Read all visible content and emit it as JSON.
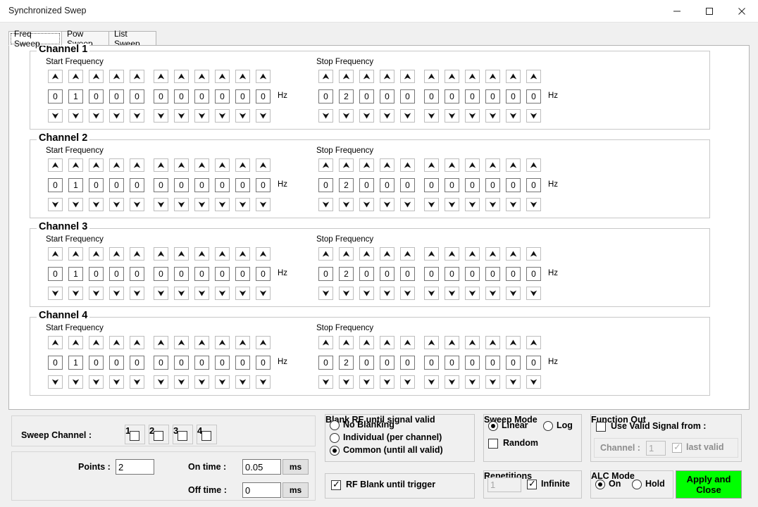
{
  "window": {
    "title": "Synchronized Swep",
    "minimize_label": "—",
    "maximize_label": "□",
    "close_label": "✕"
  },
  "tabs": [
    {
      "label": "Freq Sweep",
      "active": true
    },
    {
      "label": "Pow Sweep",
      "active": false
    },
    {
      "label": "List Sweep",
      "active": false
    }
  ],
  "channels": [
    {
      "title": "Channel 1",
      "start": {
        "label": "Start Frequency",
        "digits": [
          "0",
          "1",
          "0",
          "0",
          "0",
          "0",
          "0",
          "0",
          "0",
          "0",
          "0"
        ],
        "unit": "Hz"
      },
      "stop": {
        "label": "Stop Frequency",
        "digits": [
          "0",
          "2",
          "0",
          "0",
          "0",
          "0",
          "0",
          "0",
          "0",
          "0",
          "0"
        ],
        "unit": "Hz"
      }
    },
    {
      "title": "Channel 2",
      "start": {
        "label": "Start Frequency",
        "digits": [
          "0",
          "1",
          "0",
          "0",
          "0",
          "0",
          "0",
          "0",
          "0",
          "0",
          "0"
        ],
        "unit": "Hz"
      },
      "stop": {
        "label": "Stop Frequency",
        "digits": [
          "0",
          "2",
          "0",
          "0",
          "0",
          "0",
          "0",
          "0",
          "0",
          "0",
          "0"
        ],
        "unit": "Hz"
      }
    },
    {
      "title": "Channel 3",
      "start": {
        "label": "Start Frequency",
        "digits": [
          "0",
          "1",
          "0",
          "0",
          "0",
          "0",
          "0",
          "0",
          "0",
          "0",
          "0"
        ],
        "unit": "Hz"
      },
      "stop": {
        "label": "Stop Frequency",
        "digits": [
          "0",
          "2",
          "0",
          "0",
          "0",
          "0",
          "0",
          "0",
          "0",
          "0",
          "0"
        ],
        "unit": "Hz"
      }
    },
    {
      "title": "Channel 4",
      "start": {
        "label": "Start Frequency",
        "digits": [
          "0",
          "1",
          "0",
          "0",
          "0",
          "0",
          "0",
          "0",
          "0",
          "0",
          "0"
        ],
        "unit": "Hz"
      },
      "stop": {
        "label": "Stop Frequency",
        "digits": [
          "0",
          "2",
          "0",
          "0",
          "0",
          "0",
          "0",
          "0",
          "0",
          "0",
          "0"
        ],
        "unit": "Hz"
      }
    }
  ],
  "sweep_channel": {
    "label": "Sweep Channel :",
    "items": [
      {
        "label": "1",
        "checked": false
      },
      {
        "label": "2",
        "checked": false
      },
      {
        "label": "3",
        "checked": false
      },
      {
        "label": "4",
        "checked": false
      }
    ]
  },
  "timing": {
    "points_label": "Points :",
    "points_value": "2",
    "on_time_label": "On time :",
    "on_time_value": "0.05",
    "on_time_unit": "ms",
    "off_time_label": "Off time :",
    "off_time_value": "0",
    "off_time_unit": "ms"
  },
  "blank_rf": {
    "title": "Blank RF until signal valid",
    "options": [
      {
        "label": "No Blanking",
        "selected": false
      },
      {
        "label": "Individual (per channel)",
        "selected": false
      },
      {
        "label": "Common (until all valid)",
        "selected": true
      }
    ],
    "trigger_blank": {
      "label": "RF Blank until trigger",
      "checked": true
    }
  },
  "sweep_mode": {
    "title": "Sweep Mode",
    "options": [
      {
        "label": "Linear",
        "selected": true
      },
      {
        "label": "Log",
        "selected": false
      }
    ],
    "random": {
      "label": "Random",
      "checked": false
    }
  },
  "repetitions": {
    "title": "Repetitions",
    "value": "1",
    "infinite": {
      "label": "Infinite",
      "checked": true
    }
  },
  "function_out": {
    "title": "Function Out",
    "use_valid_signal": {
      "label": "Use Valid Signal from :",
      "checked": false
    },
    "channel_label": "Channel :",
    "channel_value": "1",
    "last_valid": {
      "label": "last valid",
      "checked": true
    }
  },
  "alc_mode": {
    "title": "ALC Mode",
    "options": [
      {
        "label": "On",
        "selected": true
      },
      {
        "label": "Hold",
        "selected": false
      }
    ]
  },
  "apply_button": {
    "line1": "Apply and",
    "line2": "Close"
  },
  "colors": {
    "apply_bg": "#00ff00",
    "window_bg": "#f0f0f0",
    "page_bg": "#ffffff"
  }
}
